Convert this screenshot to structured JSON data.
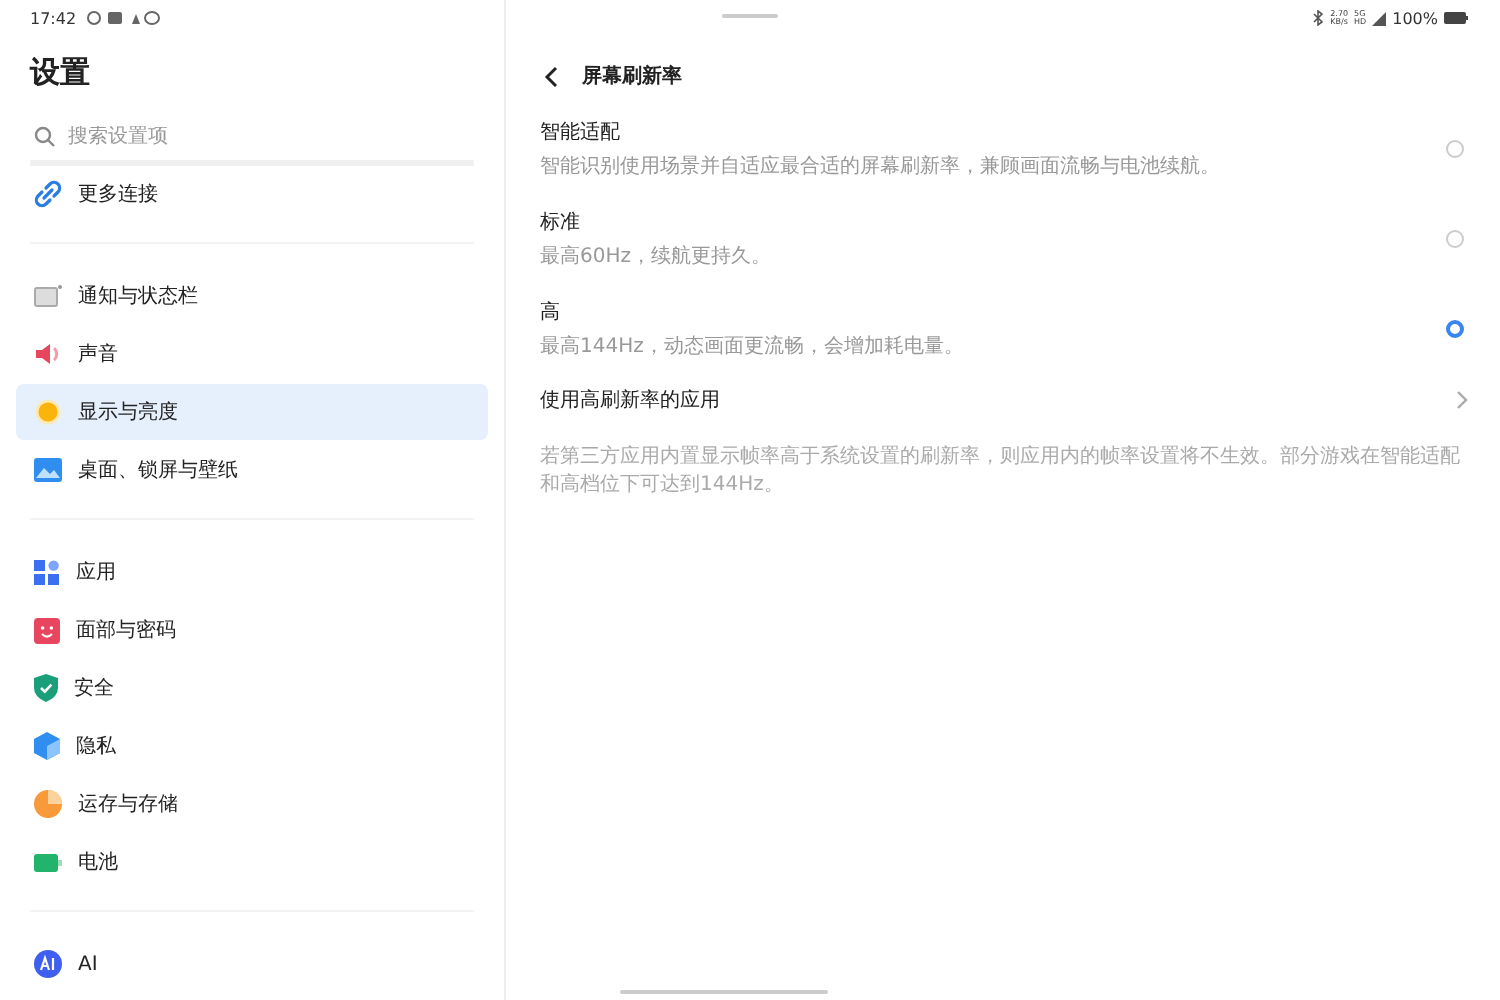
{
  "status_bar": {
    "time": "17:42",
    "speed_value": "2.70",
    "speed_unit": "KB/s",
    "network": "5G",
    "network_extra": "HD",
    "battery": "100%"
  },
  "sidebar": {
    "title": "设置",
    "search": {
      "placeholder": "搜索设置项"
    },
    "groups": [
      {
        "items": [
          {
            "kind": "link",
            "label": "更多连接",
            "selected": false
          }
        ]
      },
      {
        "items": [
          {
            "kind": "notification",
            "label": "通知与状态栏",
            "selected": false
          },
          {
            "kind": "sound",
            "label": "声音",
            "selected": false
          },
          {
            "kind": "display",
            "label": "显示与亮度",
            "selected": true
          },
          {
            "kind": "wallpaper",
            "label": "桌面、锁屏与壁纸",
            "selected": false
          }
        ]
      },
      {
        "items": [
          {
            "kind": "apps",
            "label": "应用",
            "selected": false
          },
          {
            "kind": "face",
            "label": "面部与密码",
            "selected": false
          },
          {
            "kind": "security",
            "label": "安全",
            "selected": false
          },
          {
            "kind": "privacy",
            "label": "隐私",
            "selected": false
          },
          {
            "kind": "storage",
            "label": "运存与存储",
            "selected": false
          },
          {
            "kind": "battery",
            "label": "电池",
            "selected": false
          }
        ]
      },
      {
        "items": [
          {
            "kind": "ai",
            "label": "AI",
            "selected": false
          }
        ]
      }
    ]
  },
  "detail": {
    "title": "屏幕刷新率",
    "options": [
      {
        "label": "智能适配",
        "description": "智能识别使用场景并自适应最合适的屏幕刷新率，兼顾画面流畅与电池续航。",
        "selected": false
      },
      {
        "label": "标准",
        "description": "最高60Hz，续航更持久。",
        "selected": false
      },
      {
        "label": "高",
        "description": "最高144Hz，动态画面更流畅，会增加耗电量。",
        "selected": true
      }
    ],
    "link": {
      "label": "使用高刷新率的应用"
    },
    "note": "若第三方应用内置显示帧率高于系统设置的刷新率，则应用内的帧率设置将不生效。部分游戏在智能适配和高档位下可达到144Hz。"
  }
}
